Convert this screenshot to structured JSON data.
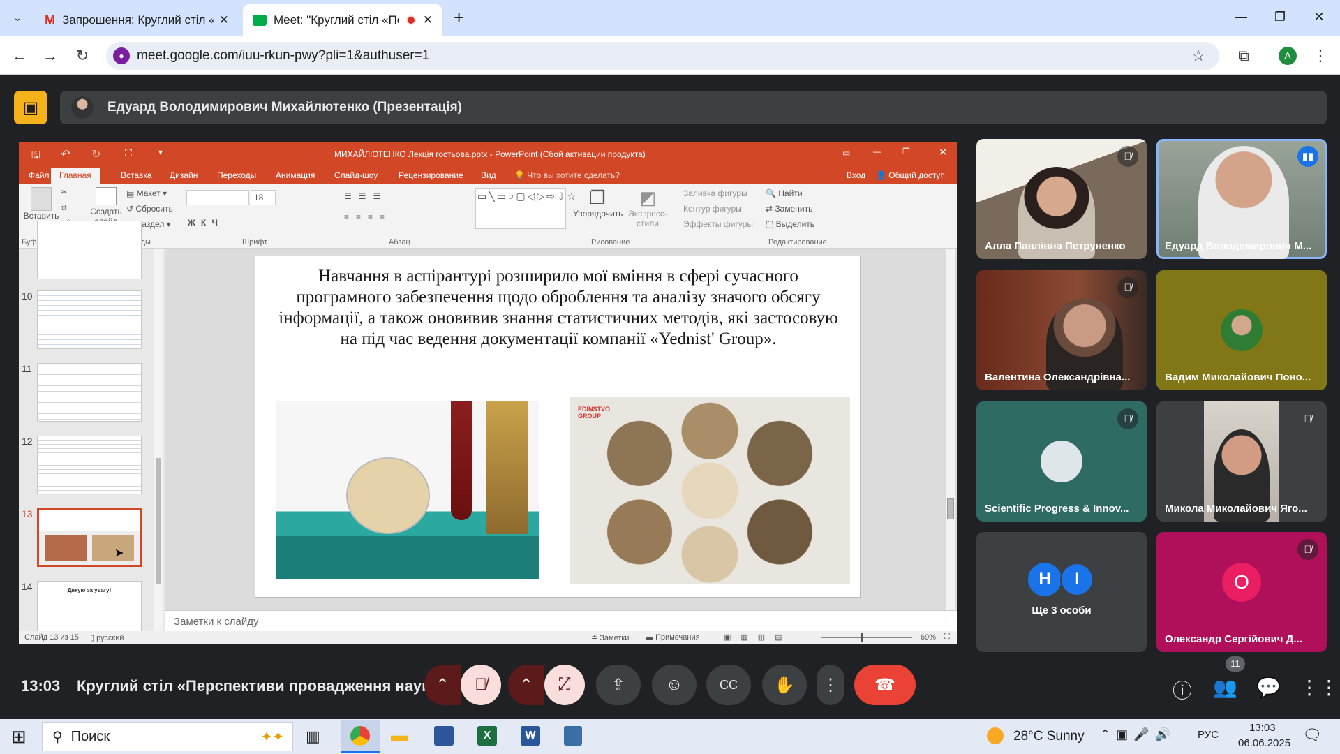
{
  "browser": {
    "tabs": [
      {
        "label": "Запрошення: Круглий стіл «Пе",
        "icon": "gmail-icon"
      },
      {
        "label": "Meet: \"Круглий стіл «Перс",
        "icon": "meet-icon",
        "recording": true
      }
    ],
    "url": "meet.google.com/iuu-rkun-pwy?pli=1&authuser=1",
    "profile_initial": "A"
  },
  "meet": {
    "presenter_banner": "Едуард Володимирович Михайлютенко (Презентація)",
    "time": "13:03",
    "meeting_title": "Круглий стіл «Перспективи провадження наук...",
    "participants_count": "11",
    "participants": [
      {
        "name": "Алла Павлівна Петруненко",
        "muted": true,
        "bg": "#8a7a6a"
      },
      {
        "name": "Едуард Володимирович М...",
        "speaking": true,
        "bg": "#7c8a7a"
      },
      {
        "name": "Валентина Олександрівна...",
        "muted": true,
        "bg": "#7a3e2e"
      },
      {
        "name": "Вадим Миколайович Поно...",
        "bg": "#827717"
      },
      {
        "name": "Scientific Progress & Innov...",
        "muted": true,
        "bg": "#2e6b62"
      },
      {
        "name": "Микола Миколайович Яго...",
        "muted": true,
        "bg": "#3c4043"
      },
      {
        "name": "Ще 3 особи",
        "initials": [
          "H",
          "I"
        ],
        "bg": "#3c4043"
      },
      {
        "name": "Олександр Сергійович Д...",
        "initial": "O",
        "muted": true,
        "bg": "#b0105a"
      }
    ]
  },
  "ppt": {
    "window_title": "МИХАЙЛЮТЕНКО Лекція гостьова.pptx - PowerPoint (Сбой активации продукта)",
    "menu": [
      "Файл",
      "Главная",
      "Вставка",
      "Дизайн",
      "Переходы",
      "Анимация",
      "Слайд-шоу",
      "Рецензирование",
      "Вид"
    ],
    "tell_me": "Что вы хотите сделать?",
    "sign_in": "Вход",
    "share": "Общий доступ",
    "ribbon": {
      "paste": "Вставить",
      "create_slide": "Создать слайд",
      "layout": "Макет",
      "reset": "Сбросить",
      "section": "Раздел",
      "font_size": "18",
      "arrange": "Упорядочить",
      "express_styles": "Экспресс-стили",
      "shape_fill": "Заливка фигуры",
      "shape_outline": "Контур фигуры",
      "shape_effects": "Эффекты фигуры",
      "find": "Найти",
      "replace": "Заменить",
      "select": "Выделить",
      "groups": [
        "Буфер обмена",
        "Слайды",
        "Шрифт",
        "Абзац",
        "Рисование",
        "Редактирование"
      ]
    },
    "thumbnails": [
      "10",
      "11",
      "12",
      "13",
      "14"
    ],
    "thumb14_text": "Дякую за увагу!",
    "slide_text": "Навчання в аспірантурі розширило мої вміння в сфері сучасного програмного забезпечення щодо оброблення та аналізу значого обсягу інформації, а також оновивив знання статистичних методів, які застосовую на під час ведення документації компанії «Yednist' Group».",
    "img2_label": "EDINSTVO GROUP",
    "notes_placeholder": "Заметки к слайду",
    "status": {
      "slide": "Слайд 13 из 15",
      "lang": "русский",
      "notes": "Заметки",
      "comments": "Примечания",
      "zoom": "69%"
    }
  },
  "taskbar": {
    "search": "Поиск",
    "weather": "28°C Sunny",
    "lang": "РУС",
    "time": "13:03",
    "date": "06.06.2025"
  }
}
